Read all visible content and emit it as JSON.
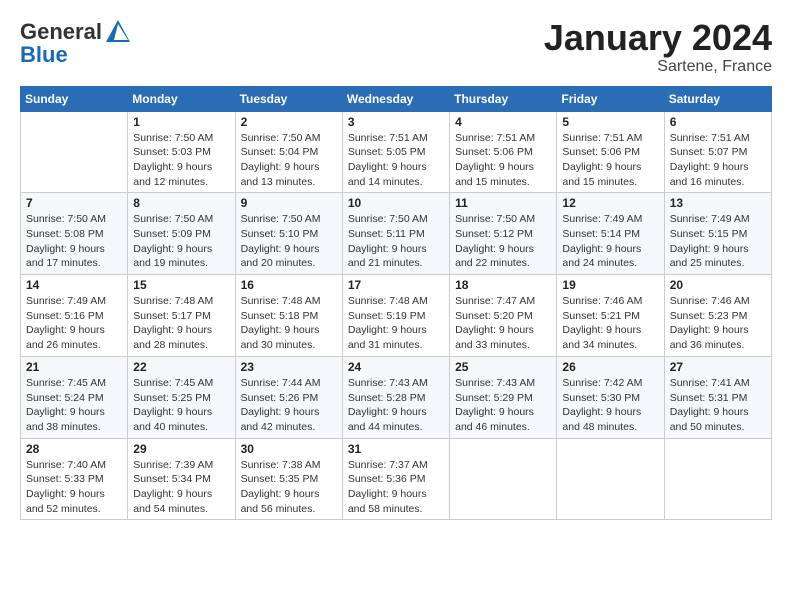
{
  "logo": {
    "general": "General",
    "blue": "Blue"
  },
  "header": {
    "month": "January 2024",
    "location": "Sartene, France"
  },
  "weekdays": [
    "Sunday",
    "Monday",
    "Tuesday",
    "Wednesday",
    "Thursday",
    "Friday",
    "Saturday"
  ],
  "weeks": [
    [
      {
        "day": "",
        "sunrise": "",
        "sunset": "",
        "daylight": ""
      },
      {
        "day": "1",
        "sunrise": "Sunrise: 7:50 AM",
        "sunset": "Sunset: 5:03 PM",
        "daylight": "Daylight: 9 hours and 12 minutes."
      },
      {
        "day": "2",
        "sunrise": "Sunrise: 7:50 AM",
        "sunset": "Sunset: 5:04 PM",
        "daylight": "Daylight: 9 hours and 13 minutes."
      },
      {
        "day": "3",
        "sunrise": "Sunrise: 7:51 AM",
        "sunset": "Sunset: 5:05 PM",
        "daylight": "Daylight: 9 hours and 14 minutes."
      },
      {
        "day": "4",
        "sunrise": "Sunrise: 7:51 AM",
        "sunset": "Sunset: 5:06 PM",
        "daylight": "Daylight: 9 hours and 15 minutes."
      },
      {
        "day": "5",
        "sunrise": "Sunrise: 7:51 AM",
        "sunset": "Sunset: 5:06 PM",
        "daylight": "Daylight: 9 hours and 15 minutes."
      },
      {
        "day": "6",
        "sunrise": "Sunrise: 7:51 AM",
        "sunset": "Sunset: 5:07 PM",
        "daylight": "Daylight: 9 hours and 16 minutes."
      }
    ],
    [
      {
        "day": "7",
        "sunrise": "Sunrise: 7:50 AM",
        "sunset": "Sunset: 5:08 PM",
        "daylight": "Daylight: 9 hours and 17 minutes."
      },
      {
        "day": "8",
        "sunrise": "Sunrise: 7:50 AM",
        "sunset": "Sunset: 5:09 PM",
        "daylight": "Daylight: 9 hours and 19 minutes."
      },
      {
        "day": "9",
        "sunrise": "Sunrise: 7:50 AM",
        "sunset": "Sunset: 5:10 PM",
        "daylight": "Daylight: 9 hours and 20 minutes."
      },
      {
        "day": "10",
        "sunrise": "Sunrise: 7:50 AM",
        "sunset": "Sunset: 5:11 PM",
        "daylight": "Daylight: 9 hours and 21 minutes."
      },
      {
        "day": "11",
        "sunrise": "Sunrise: 7:50 AM",
        "sunset": "Sunset: 5:12 PM",
        "daylight": "Daylight: 9 hours and 22 minutes."
      },
      {
        "day": "12",
        "sunrise": "Sunrise: 7:49 AM",
        "sunset": "Sunset: 5:14 PM",
        "daylight": "Daylight: 9 hours and 24 minutes."
      },
      {
        "day": "13",
        "sunrise": "Sunrise: 7:49 AM",
        "sunset": "Sunset: 5:15 PM",
        "daylight": "Daylight: 9 hours and 25 minutes."
      }
    ],
    [
      {
        "day": "14",
        "sunrise": "Sunrise: 7:49 AM",
        "sunset": "Sunset: 5:16 PM",
        "daylight": "Daylight: 9 hours and 26 minutes."
      },
      {
        "day": "15",
        "sunrise": "Sunrise: 7:48 AM",
        "sunset": "Sunset: 5:17 PM",
        "daylight": "Daylight: 9 hours and 28 minutes."
      },
      {
        "day": "16",
        "sunrise": "Sunrise: 7:48 AM",
        "sunset": "Sunset: 5:18 PM",
        "daylight": "Daylight: 9 hours and 30 minutes."
      },
      {
        "day": "17",
        "sunrise": "Sunrise: 7:48 AM",
        "sunset": "Sunset: 5:19 PM",
        "daylight": "Daylight: 9 hours and 31 minutes."
      },
      {
        "day": "18",
        "sunrise": "Sunrise: 7:47 AM",
        "sunset": "Sunset: 5:20 PM",
        "daylight": "Daylight: 9 hours and 33 minutes."
      },
      {
        "day": "19",
        "sunrise": "Sunrise: 7:46 AM",
        "sunset": "Sunset: 5:21 PM",
        "daylight": "Daylight: 9 hours and 34 minutes."
      },
      {
        "day": "20",
        "sunrise": "Sunrise: 7:46 AM",
        "sunset": "Sunset: 5:23 PM",
        "daylight": "Daylight: 9 hours and 36 minutes."
      }
    ],
    [
      {
        "day": "21",
        "sunrise": "Sunrise: 7:45 AM",
        "sunset": "Sunset: 5:24 PM",
        "daylight": "Daylight: 9 hours and 38 minutes."
      },
      {
        "day": "22",
        "sunrise": "Sunrise: 7:45 AM",
        "sunset": "Sunset: 5:25 PM",
        "daylight": "Daylight: 9 hours and 40 minutes."
      },
      {
        "day": "23",
        "sunrise": "Sunrise: 7:44 AM",
        "sunset": "Sunset: 5:26 PM",
        "daylight": "Daylight: 9 hours and 42 minutes."
      },
      {
        "day": "24",
        "sunrise": "Sunrise: 7:43 AM",
        "sunset": "Sunset: 5:28 PM",
        "daylight": "Daylight: 9 hours and 44 minutes."
      },
      {
        "day": "25",
        "sunrise": "Sunrise: 7:43 AM",
        "sunset": "Sunset: 5:29 PM",
        "daylight": "Daylight: 9 hours and 46 minutes."
      },
      {
        "day": "26",
        "sunrise": "Sunrise: 7:42 AM",
        "sunset": "Sunset: 5:30 PM",
        "daylight": "Daylight: 9 hours and 48 minutes."
      },
      {
        "day": "27",
        "sunrise": "Sunrise: 7:41 AM",
        "sunset": "Sunset: 5:31 PM",
        "daylight": "Daylight: 9 hours and 50 minutes."
      }
    ],
    [
      {
        "day": "28",
        "sunrise": "Sunrise: 7:40 AM",
        "sunset": "Sunset: 5:33 PM",
        "daylight": "Daylight: 9 hours and 52 minutes."
      },
      {
        "day": "29",
        "sunrise": "Sunrise: 7:39 AM",
        "sunset": "Sunset: 5:34 PM",
        "daylight": "Daylight: 9 hours and 54 minutes."
      },
      {
        "day": "30",
        "sunrise": "Sunrise: 7:38 AM",
        "sunset": "Sunset: 5:35 PM",
        "daylight": "Daylight: 9 hours and 56 minutes."
      },
      {
        "day": "31",
        "sunrise": "Sunrise: 7:37 AM",
        "sunset": "Sunset: 5:36 PM",
        "daylight": "Daylight: 9 hours and 58 minutes."
      },
      {
        "day": "",
        "sunrise": "",
        "sunset": "",
        "daylight": ""
      },
      {
        "day": "",
        "sunrise": "",
        "sunset": "",
        "daylight": ""
      },
      {
        "day": "",
        "sunrise": "",
        "sunset": "",
        "daylight": ""
      }
    ]
  ]
}
